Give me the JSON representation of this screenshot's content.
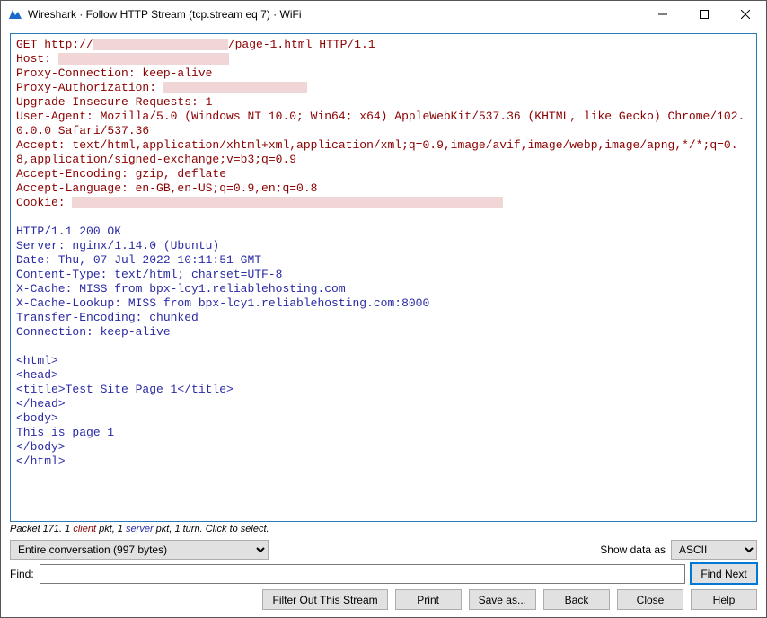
{
  "window": {
    "title": "Wireshark · Follow HTTP Stream (tcp.stream eq 7) · WiFi"
  },
  "request": {
    "line1a": "GET http://",
    "line1b": "/page-1.html HTTP/1.1",
    "host_label": "Host: ",
    "proxy_conn": "Proxy-Connection: keep-alive",
    "proxy_auth_label": "Proxy-Authorization: ",
    "upgrade": "Upgrade-Insecure-Requests: 1",
    "ua": "User-Agent: Mozilla/5.0 (Windows NT 10.0; Win64; x64) AppleWebKit/537.36 (KHTML, like Gecko) Chrome/102.0.0.0 Safari/537.36",
    "accept": "Accept: text/html,application/xhtml+xml,application/xml;q=0.9,image/avif,image/webp,image/apng,*/*;q=0.8,application/signed-exchange;v=b3;q=0.9",
    "accept_enc": "Accept-Encoding: gzip, deflate",
    "accept_lang": "Accept-Language: en-GB,en-US;q=0.9,en;q=0.8",
    "cookie_label": "Cookie: "
  },
  "response": {
    "status": "HTTP/1.1 200 OK",
    "server": "Server: nginx/1.14.0 (Ubuntu)",
    "date": "Date: Thu, 07 Jul 2022 10:11:51 GMT",
    "ctype": "Content-Type: text/html; charset=UTF-8",
    "xcache": "X-Cache: MISS from bpx-lcy1.reliablehosting.com",
    "xcachelookup": "X-Cache-Lookup: MISS from bpx-lcy1.reliablehosting.com:8000",
    "tenc": "Transfer-Encoding: chunked",
    "conn": "Connection: keep-alive",
    "body_html_open": "<html>",
    "body_head_open": "<head>",
    "body_title": "<title>Test Site Page 1</title>",
    "body_head_close": "</head>",
    "body_body_open": "<body>",
    "body_text": "This is page 1",
    "body_body_close": "</body>",
    "body_html_close": "</html>"
  },
  "status": {
    "prefix": "Packet 171. 1 ",
    "client_word": "client",
    "mid": " pkt, 1 ",
    "server_word": "server",
    "suffix": " pkt, 1 turn. Click to select."
  },
  "controls": {
    "conversation_option": "Entire conversation (997 bytes)",
    "show_as_label": "Show data as",
    "show_as_option": "ASCII",
    "find_label": "Find:",
    "find_value": "",
    "find_next": "Find Next",
    "filter_out": "Filter Out This Stream",
    "print": "Print",
    "save_as": "Save as...",
    "back": "Back",
    "close": "Close",
    "help": "Help"
  }
}
